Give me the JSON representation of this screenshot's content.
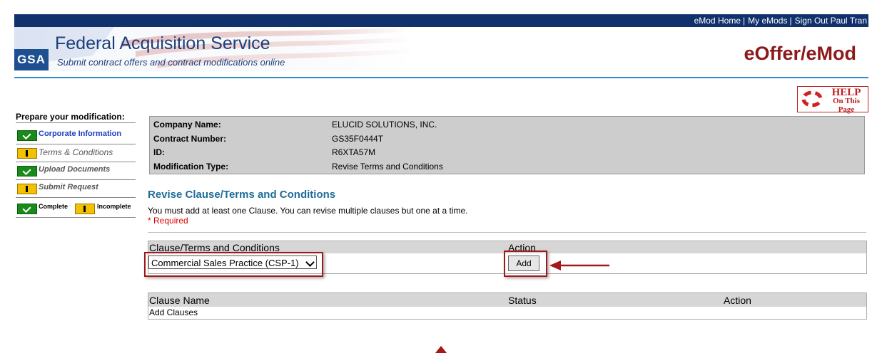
{
  "top_links": [
    "eMod Home",
    "My eMods",
    "Sign Out Paul Tran"
  ],
  "separator": "|",
  "header": {
    "logo_text": "GSA",
    "title": "Federal Acquisition Service",
    "subtitle": "Submit contract offers and contract modifications online",
    "brand": "eOffer/eMod"
  },
  "help": {
    "line1": "HELP",
    "line2": "On This Page",
    "icon": "lifebuoy-icon"
  },
  "sidebar": {
    "title": "Prepare your modification:",
    "items": [
      {
        "label": "Corporate Information",
        "status": "complete"
      },
      {
        "label": "Terms & Conditions",
        "status": "incomplete"
      },
      {
        "label": "Upload Documents",
        "status": "complete"
      },
      {
        "label": "Submit Request",
        "status": "incomplete"
      }
    ],
    "legend": {
      "complete": "Complete",
      "incomplete": "Incomplete"
    }
  },
  "info": [
    {
      "key": "Company Name:",
      "value": "ELUCID SOLUTIONS, INC."
    },
    {
      "key": "Contract Number:",
      "value": "GS35F0444T"
    },
    {
      "key": "ID:",
      "value": "R6XTA57M"
    },
    {
      "key": "Modification Type:",
      "value": "Revise Terms and Conditions"
    }
  ],
  "section": {
    "title": "Revise Clause/Terms and Conditions",
    "note": "You must add at least one Clause. You can revise multiple clauses but one at a time.",
    "required": "* Required"
  },
  "clause_table": {
    "headers": [
      "Clause/Terms and Conditions",
      "Action"
    ],
    "selected": "Commercial Sales Practice (CSP-1)",
    "add_label": "Add"
  },
  "clauses_list": {
    "headers": [
      "Clause Name",
      "Status",
      "Action"
    ],
    "empty_text": "Add Clauses"
  },
  "colors": {
    "topbar": "#10316b",
    "brand": "#8b1a1a",
    "section_title": "#1f6d99",
    "annotation": "#a31818"
  }
}
